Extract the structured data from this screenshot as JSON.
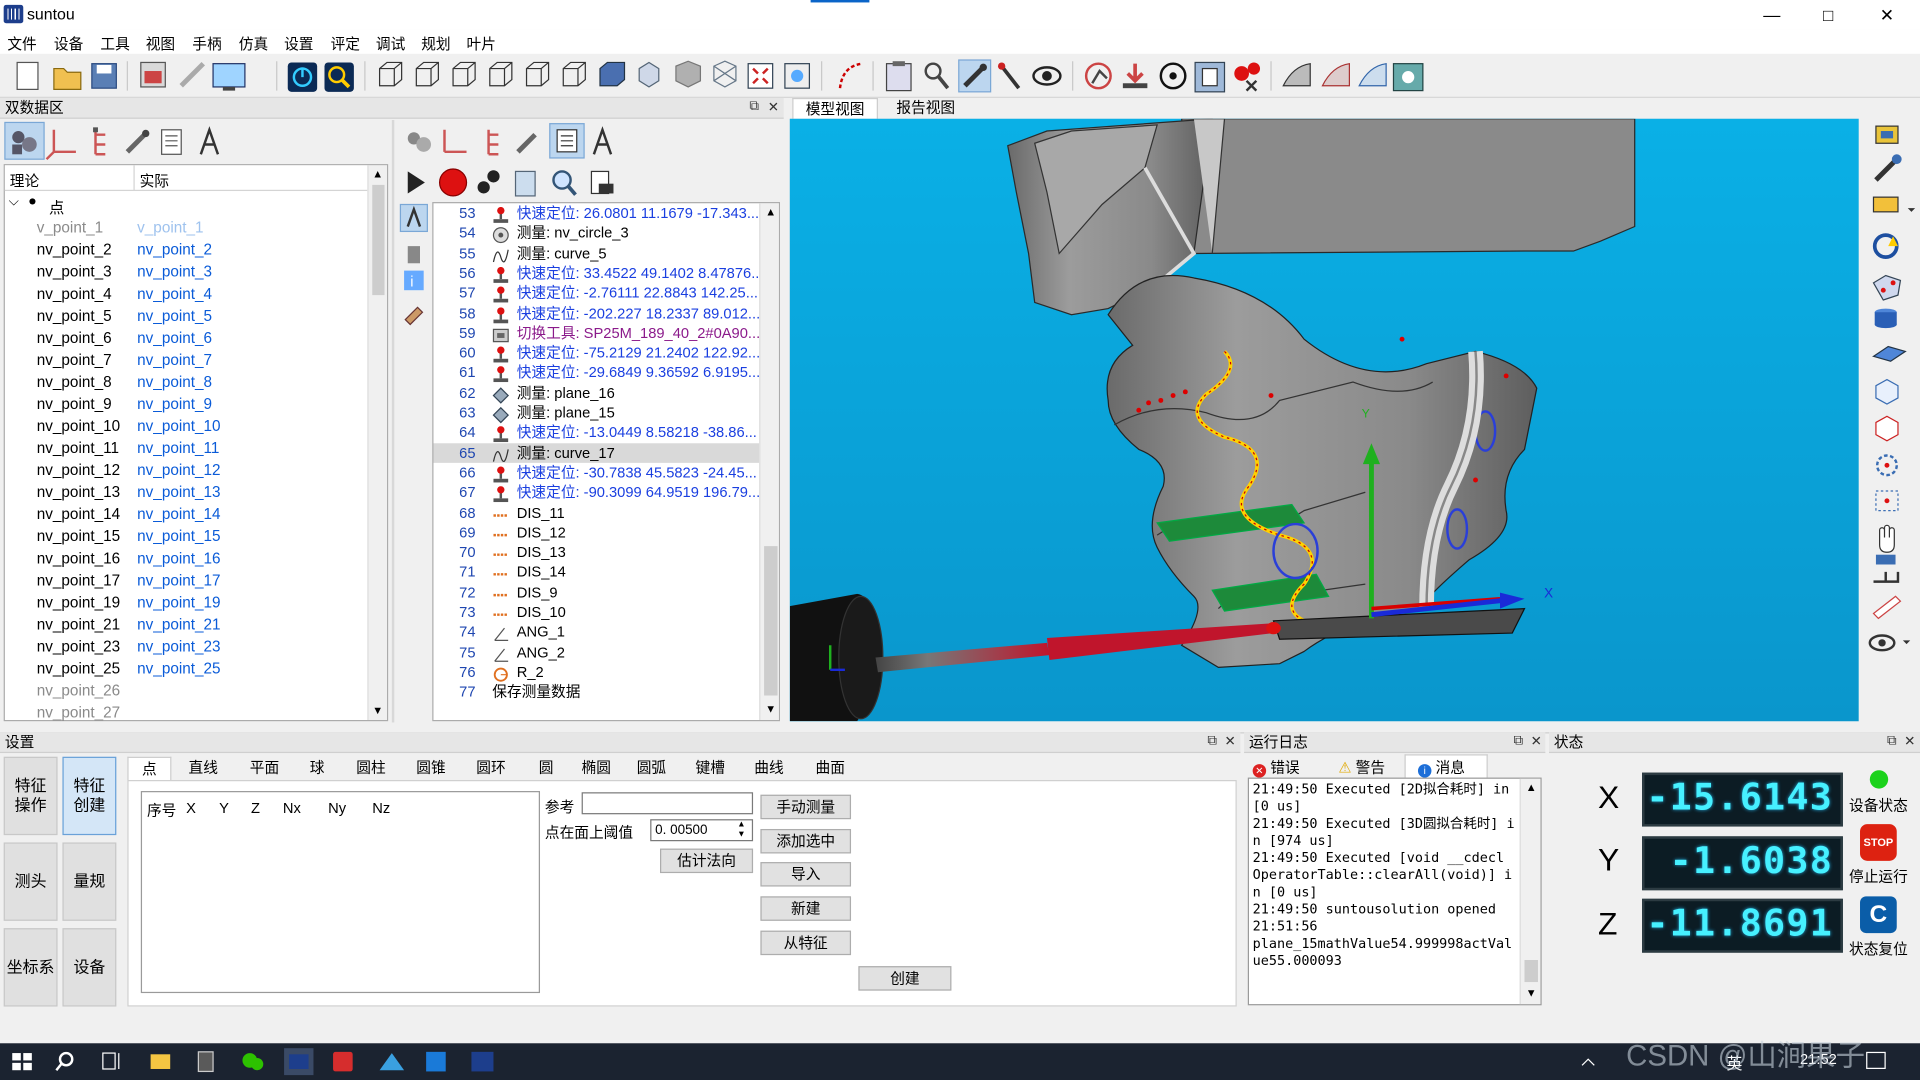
{
  "window": {
    "title": "suntou",
    "min": "—",
    "max": "□",
    "close": "✕"
  },
  "menu": [
    "文件",
    "设备",
    "工具",
    "视图",
    "手柄",
    "仿真",
    "设置",
    "评定",
    "调试",
    "规划",
    "叶片"
  ],
  "left_panel": {
    "title": "双数据区",
    "col_theory": "理论",
    "col_actual": "实际",
    "root_label": "点",
    "points": [
      {
        "t": "v_point_1",
        "a": "v_point_1",
        "style": "first"
      },
      {
        "t": "nv_point_2",
        "a": "nv_point_2"
      },
      {
        "t": "nv_point_3",
        "a": "nv_point_3"
      },
      {
        "t": "nv_point_4",
        "a": "nv_point_4"
      },
      {
        "t": "nv_point_5",
        "a": "nv_point_5"
      },
      {
        "t": "nv_point_6",
        "a": "nv_point_6"
      },
      {
        "t": "nv_point_7",
        "a": "nv_point_7"
      },
      {
        "t": "nv_point_8",
        "a": "nv_point_8"
      },
      {
        "t": "nv_point_9",
        "a": "nv_point_9"
      },
      {
        "t": "nv_point_10",
        "a": "nv_point_10"
      },
      {
        "t": "nv_point_11",
        "a": "nv_point_11"
      },
      {
        "t": "nv_point_12",
        "a": "nv_point_12"
      },
      {
        "t": "nv_point_13",
        "a": "nv_point_13"
      },
      {
        "t": "nv_point_14",
        "a": "nv_point_14"
      },
      {
        "t": "nv_point_15",
        "a": "nv_point_15"
      },
      {
        "t": "nv_point_16",
        "a": "nv_point_16"
      },
      {
        "t": "nv_point_17",
        "a": "nv_point_17"
      },
      {
        "t": "nv_point_19",
        "a": "nv_point_19"
      },
      {
        "t": "nv_point_21",
        "a": "nv_point_21"
      },
      {
        "t": "nv_point_23",
        "a": "nv_point_23"
      },
      {
        "t": "nv_point_25",
        "a": "nv_point_25"
      },
      {
        "t": "nv_point_26",
        "a": "",
        "style": "gray"
      },
      {
        "t": "nv_point_27",
        "a": "",
        "style": "gray"
      }
    ]
  },
  "program": {
    "rows": [
      {
        "n": "53",
        "icon": "probe",
        "text": "快速定位: 26.0801 11.1679 -17.343...",
        "c": "blue"
      },
      {
        "n": "54",
        "icon": "circle",
        "text": "测量: nv_circle_3",
        "c": "black"
      },
      {
        "n": "55",
        "icon": "curve",
        "text": "测量: curve_5",
        "c": "black"
      },
      {
        "n": "56",
        "icon": "probe",
        "text": "快速定位: 33.4522 49.1402 8.47876...",
        "c": "blue"
      },
      {
        "n": "57",
        "icon": "probe",
        "text": "快速定位: -2.76111 22.8843 142.25...",
        "c": "blue"
      },
      {
        "n": "58",
        "icon": "probe",
        "text": "快速定位: -202.227 18.2337 89.012...",
        "c": "blue"
      },
      {
        "n": "59",
        "icon": "tool",
        "text": "切换工具: SP25M_189_40_2#0A90...",
        "c": "purple"
      },
      {
        "n": "60",
        "icon": "probe",
        "text": "快速定位: -75.2129 21.2402 122.92...",
        "c": "blue"
      },
      {
        "n": "61",
        "icon": "probe",
        "text": "快速定位: -29.6849 9.36592 6.9195...",
        "c": "blue"
      },
      {
        "n": "62",
        "icon": "plane",
        "text": "测量: plane_16",
        "c": "black"
      },
      {
        "n": "63",
        "icon": "plane",
        "text": "测量: plane_15",
        "c": "black"
      },
      {
        "n": "64",
        "icon": "probe",
        "text": "快速定位: -13.0449 8.58218 -38.86...",
        "c": "blue"
      },
      {
        "n": "65",
        "icon": "curve",
        "text": "测量: curve_17",
        "c": "black",
        "sel": true
      },
      {
        "n": "66",
        "icon": "probe",
        "text": "快速定位: -30.7838 45.5823 -24.45...",
        "c": "blue"
      },
      {
        "n": "67",
        "icon": "probe",
        "text": "快速定位: -90.3099 64.9519 196.79...",
        "c": "blue"
      },
      {
        "n": "68",
        "icon": "dis",
        "text": "DIS_11",
        "c": "black"
      },
      {
        "n": "69",
        "icon": "dis",
        "text": "DIS_12",
        "c": "black"
      },
      {
        "n": "70",
        "icon": "dis",
        "text": "DIS_13",
        "c": "black"
      },
      {
        "n": "71",
        "icon": "dis",
        "text": "DIS_14",
        "c": "black"
      },
      {
        "n": "72",
        "icon": "dis",
        "text": "DIS_9",
        "c": "black"
      },
      {
        "n": "73",
        "icon": "dis",
        "text": "DIS_10",
        "c": "black"
      },
      {
        "n": "74",
        "icon": "ang",
        "text": "ANG_1",
        "c": "black"
      },
      {
        "n": "75",
        "icon": "ang",
        "text": "ANG_2",
        "c": "black"
      },
      {
        "n": "76",
        "icon": "rad",
        "text": "R_2",
        "c": "black"
      },
      {
        "n": "77",
        "icon": "none",
        "text": "保存测量数据",
        "c": "black"
      }
    ]
  },
  "view_tabs": [
    "模型视图",
    "报告视图"
  ],
  "viewport": {
    "axis_x": "X",
    "axis_y": "Y"
  },
  "settings": {
    "title": "设置",
    "side_buttons": [
      "特征\n操作",
      "特征\n创建",
      "测头",
      "量规",
      "坐标系",
      "设备"
    ],
    "feature_tabs": [
      "点",
      "直线",
      "平面",
      "球",
      "圆柱",
      "圆锥",
      "圆环",
      "圆",
      "椭圆",
      "圆弧",
      "键槽",
      "曲线",
      "曲面"
    ],
    "cols": [
      "序号",
      "X",
      "Y",
      "Z",
      "Nx",
      "Ny",
      "Nz"
    ],
    "ref_label": "参考",
    "threshold_label": "点在面上阈值",
    "threshold_value": "0. 00500",
    "estimate_btn": "估计法向",
    "buttons": [
      "手动测量",
      "添加选中",
      "导入",
      "新建",
      "从特征"
    ],
    "create_btn": "创建"
  },
  "log": {
    "title": "运行日志",
    "tabs": [
      "错误",
      "警告",
      "消息"
    ],
    "text": "21:49:50 Executed [2D拟合耗时] in [0 us]\n21:49:50 Executed [3D圆拟合耗时] in [974 us]\n21:49:50 Executed [void __cdecl OperatorTable::clearAll(void)] in [0 us]\n21:49:50 suntousolution opened\n21:51:56\nplane_15mathValue54.999998actValue55.000093"
  },
  "status": {
    "title": "状态",
    "x_label": "X",
    "x_value": "-15.6143",
    "y_label": "Y",
    "y_value": "-1.6038",
    "z_label": "Z",
    "z_value": "-11.8691",
    "device_state": "设备状态",
    "stop_run": "停止运行",
    "stop_icon_text": "STOP",
    "reset": "状态复位"
  },
  "taskbar": {
    "time": "21:52",
    "ime": "英",
    "watermark": "CSDN @山涧果子"
  }
}
